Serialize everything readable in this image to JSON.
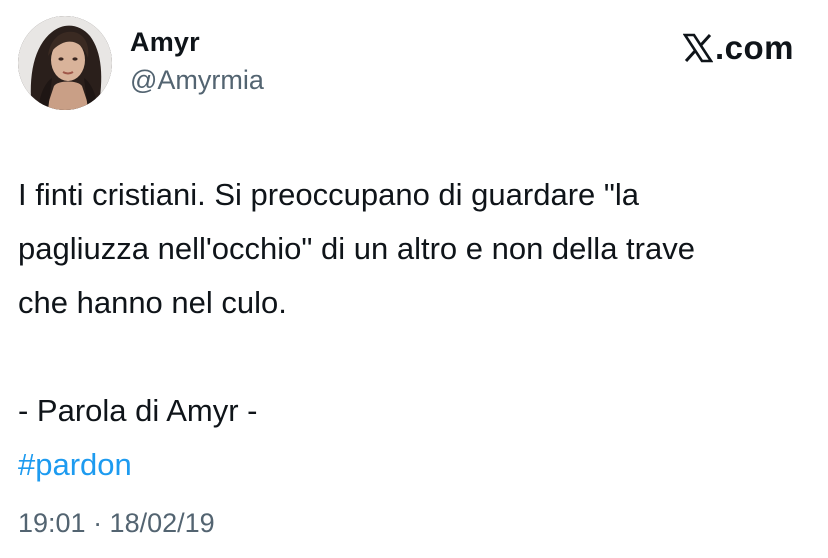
{
  "author": {
    "display_name": "Amyr",
    "handle": "@Amyrmia",
    "avatar_icon": "profile-photo"
  },
  "brand": {
    "icon": "x-logo-icon",
    "text": "X.com"
  },
  "tweet": {
    "lines": [
      "I finti cristiani. Si preoccupano di guardare \"la",
      "pagliuzza nell'occhio\" di un altro e non della trave",
      "che hanno nel culo."
    ],
    "signature": "- Parola di Amyr -",
    "hashtag": "#pardon",
    "timestamp": "19:01 · 18/02/19"
  },
  "colors": {
    "text": "#0f1419",
    "secondary": "#536471",
    "link": "#1d9bf0",
    "background": "#ffffff"
  }
}
